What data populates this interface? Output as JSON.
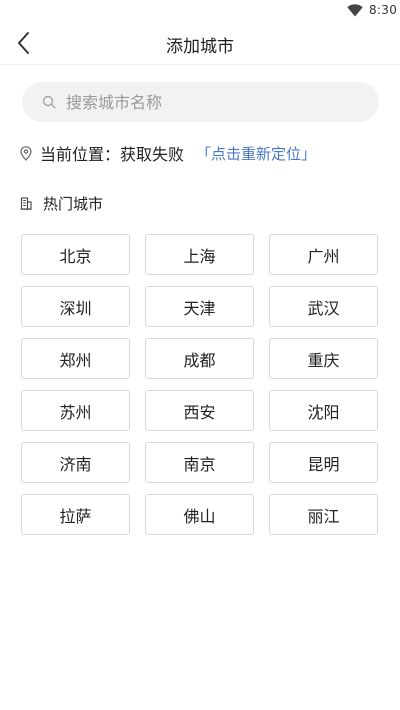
{
  "status_bar": {
    "time": "8:30",
    "wifi_icon": "wifi-icon"
  },
  "header": {
    "back_icon": "chevron-left-icon",
    "title": "添加城市"
  },
  "search": {
    "icon": "search-icon",
    "placeholder": "搜索城市名称",
    "value": ""
  },
  "location": {
    "icon": "location-pin-icon",
    "label": "当前位置：",
    "status": "获取失败",
    "relocate": "「点击重新定位」"
  },
  "hot_cities": {
    "icon": "building-icon",
    "title": "热门城市",
    "cities": [
      "北京",
      "上海",
      "广州",
      "深圳",
      "天津",
      "武汉",
      "郑州",
      "成都",
      "重庆",
      "苏州",
      "西安",
      "沈阳",
      "济南",
      "南京",
      "昆明",
      "拉萨",
      "佛山",
      "丽江"
    ]
  },
  "colors": {
    "link": "#4a79c8",
    "search_bg": "#f2f2f2",
    "chip_border": "#d9d9d9"
  }
}
